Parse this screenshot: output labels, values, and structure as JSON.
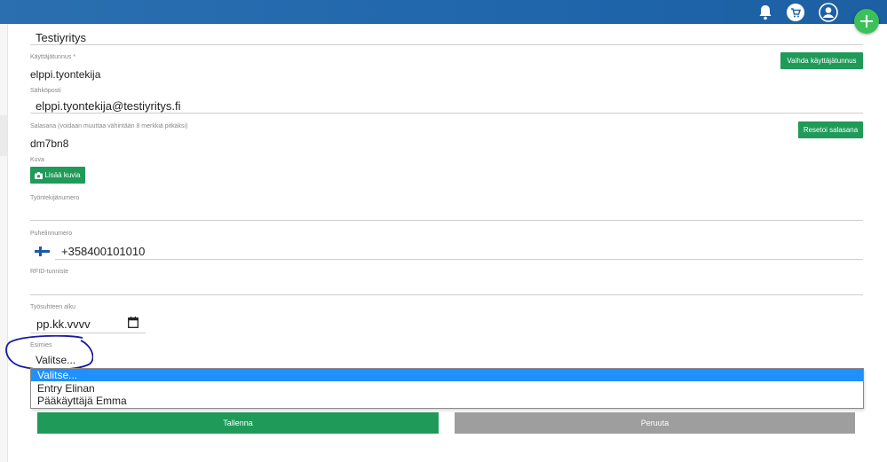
{
  "header": {
    "icons": [
      "bell-icon",
      "cart-icon",
      "user-icon"
    ],
    "fab_icon": "plus-icon",
    "bar_color": "#1f66ab",
    "fab_color": "#3cc15a"
  },
  "form": {
    "company_value": "Testiyritys",
    "username": {
      "label": "Käyttäjätunnus *",
      "value": "elppi.tyontekija",
      "button": "Vaihda käyttäjätunnus"
    },
    "email": {
      "label": "Sähköposti",
      "value": "elppi.tyontekija@testiyritys.fi"
    },
    "password": {
      "label": "Salasana (voidaan muuttaa vähintään 8 merkkiä pitkäksi)",
      "value": "dm7bn8",
      "button": "Resetoi salasana"
    },
    "image": {
      "label": "Kuva",
      "button": "Lisää kuvia"
    },
    "employee_number": {
      "label": "Työntekijänumero",
      "value": ""
    },
    "phone": {
      "label": "Puhelinnumero",
      "value": "+358400101010"
    },
    "rfid": {
      "label": "RFID-tunniste",
      "value": ""
    },
    "start_date": {
      "label": "Työsuhteen alku",
      "placeholder": "pp.kk.vvvv"
    },
    "supervisor": {
      "label": "Esimies",
      "value": "Valitse...",
      "options": [
        "Valitse...",
        "Entry Elinan",
        "Pääkäyttäjä Emma"
      ],
      "selected_index": 0
    },
    "save_label": "Tallenna",
    "cancel_label": "Peruuta"
  },
  "colors": {
    "accent_green": "#1f9a59",
    "cancel_gray": "#9e9e9e",
    "selection_blue": "#1e90ff",
    "annotation": "#1a1aa0"
  }
}
